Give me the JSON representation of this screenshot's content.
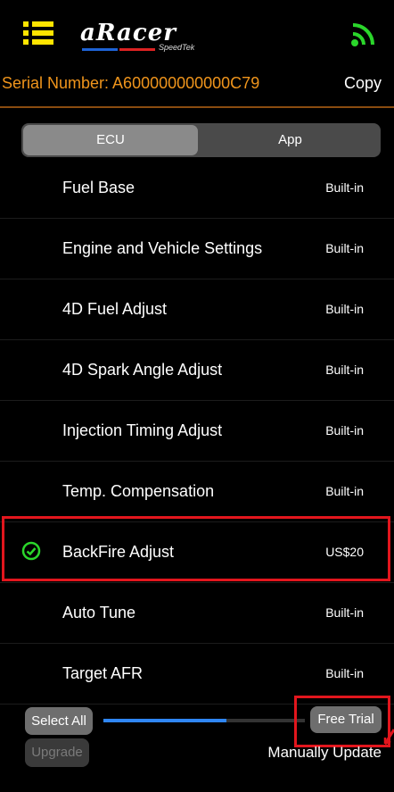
{
  "header": {
    "logo_text": "aRacer",
    "logo_sub": "SpeedTek",
    "icons": {
      "menu": "menu-grid-icon",
      "connection": "wifi-signal-icon"
    },
    "colors": {
      "menu": "#ffe400",
      "signal": "#2bd62b"
    }
  },
  "serial": {
    "label": "Serial Number: A600000000000C79",
    "copy_label": "Copy",
    "color": "#f0951c"
  },
  "tabs": [
    {
      "label": "ECU",
      "selected": true
    },
    {
      "label": "App",
      "selected": false
    }
  ],
  "items": [
    {
      "label": "Fuel Base",
      "value": "Built-in"
    },
    {
      "label": "Engine and Vehicle Settings",
      "value": "Built-in"
    },
    {
      "label": "4D Fuel Adjust",
      "value": "Built-in"
    },
    {
      "label": "4D Spark Angle Adjust",
      "value": "Built-in"
    },
    {
      "label": "Injection Timing Adjust",
      "value": "Built-in"
    },
    {
      "label": "Temp. Compensation",
      "value": "Built-in"
    },
    {
      "label": "BackFire Adjust",
      "value": "US$20",
      "checked": true
    },
    {
      "label": "Auto Tune",
      "value": "Built-in"
    },
    {
      "label": "Target AFR",
      "value": "Built-in"
    }
  ],
  "footer": {
    "select_all": "Select All",
    "free_trial": "Free Trial",
    "upgrade": "Upgrade",
    "manual_update": "Manually Update",
    "progress": 0.61
  },
  "highlight_color": "#e2161d"
}
